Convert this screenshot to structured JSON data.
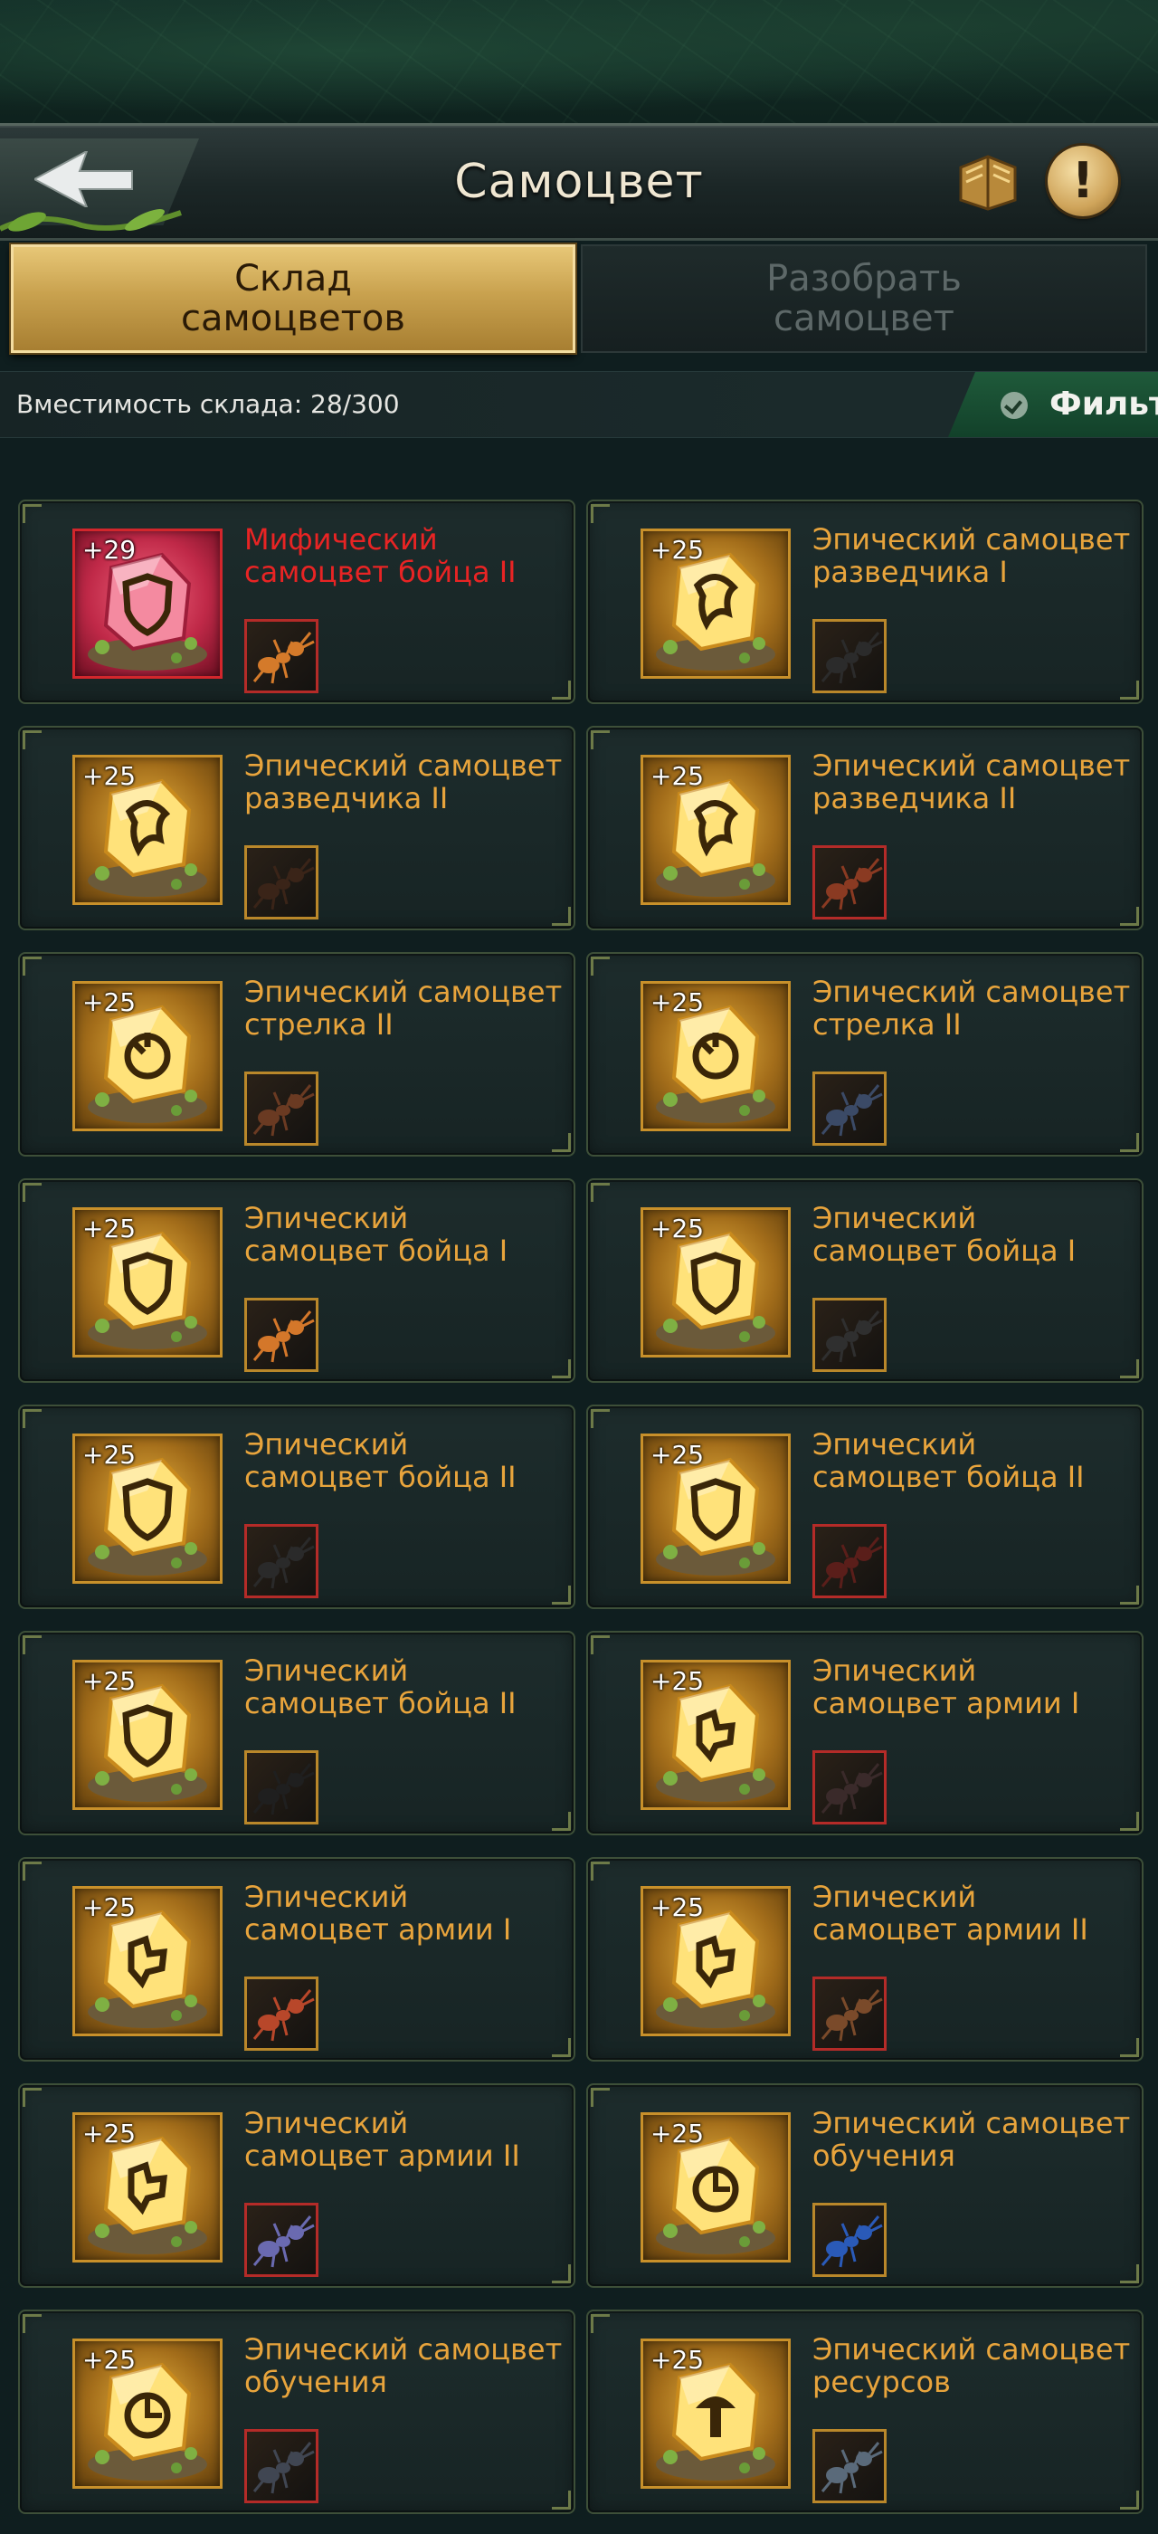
{
  "header": {
    "title": "Самоцвет",
    "back_icon": "back-arrow-icon",
    "book_icon": "book-icon",
    "info_icon": "info-icon",
    "info_glyph": "!"
  },
  "tabs": [
    {
      "label": "Склад\nсамоцветов",
      "active": true
    },
    {
      "label": "Разобрать\nсамоцвет",
      "active": false
    }
  ],
  "capacity": {
    "text": "Вместимость склада: 28/300"
  },
  "filter": {
    "label": "Фильт"
  },
  "colors": {
    "epic": "#e8a43c",
    "mythic": "#e82424",
    "tab_active": "#c9a24f",
    "filter_green": "#1f5a3a"
  },
  "gems": [
    {
      "level": "+29",
      "name": "Мифический\nсамоцвет бойца II",
      "rarity": "mythic",
      "slot": "red",
      "insect_color": "#d47a2a",
      "emblem": "shield"
    },
    {
      "level": "+25",
      "name": "Эпический самоцвет\nразведчика I",
      "rarity": "epic",
      "slot": "gold",
      "insect_color": "#2b2b2b",
      "emblem": "scout"
    },
    {
      "level": "+25",
      "name": "Эпический самоцвет\nразведчика II",
      "rarity": "epic",
      "slot": "gold",
      "insect_color": "#3a2418",
      "emblem": "scout"
    },
    {
      "level": "+25",
      "name": "Эпический самоцвет\nразведчика II",
      "rarity": "epic",
      "slot": "red",
      "insect_color": "#8a3a22",
      "emblem": "scout"
    },
    {
      "level": "+25",
      "name": "Эпический самоцвет\nстрелка II",
      "rarity": "epic",
      "slot": "gold",
      "insect_color": "#6a3a22",
      "emblem": "archer"
    },
    {
      "level": "+25",
      "name": "Эпический самоцвет\nстрелка II",
      "rarity": "epic",
      "slot": "gold",
      "insect_color": "#3b4a66",
      "emblem": "archer"
    },
    {
      "level": "+25",
      "name": "Эпический\nсамоцвет бойца I",
      "rarity": "epic",
      "slot": "gold",
      "insect_color": "#d4772a",
      "emblem": "shield"
    },
    {
      "level": "+25",
      "name": "Эпический\nсамоцвет бойца I",
      "rarity": "epic",
      "slot": "gold",
      "insect_color": "#2f2f2f",
      "emblem": "shield"
    },
    {
      "level": "+25",
      "name": "Эпический\nсамоцвет бойца II",
      "rarity": "epic",
      "slot": "red",
      "insect_color": "#2a2a2a",
      "emblem": "shield"
    },
    {
      "level": "+25",
      "name": "Эпический\nсамоцвет бойца II",
      "rarity": "epic",
      "slot": "red",
      "insect_color": "#5a1e1a",
      "emblem": "shield"
    },
    {
      "level": "+25",
      "name": "Эпический\nсамоцвет бойца II",
      "rarity": "epic",
      "slot": "gold",
      "insect_color": "#1f1f1f",
      "emblem": "shield"
    },
    {
      "level": "+25",
      "name": "Эпический\nсамоцвет армии I",
      "rarity": "epic",
      "slot": "red",
      "insect_color": "#3a2a2a",
      "emblem": "army"
    },
    {
      "level": "+25",
      "name": "Эпический\nсамоцвет армии I",
      "rarity": "epic",
      "slot": "gold",
      "insect_color": "#b8472a",
      "emblem": "army"
    },
    {
      "level": "+25",
      "name": "Эпический\nсамоцвет армии II",
      "rarity": "epic",
      "slot": "red",
      "insect_color": "#7a4a2a",
      "emblem": "army"
    },
    {
      "level": "+25",
      "name": "Эпический\nсамоцвет армии II",
      "rarity": "epic",
      "slot": "red",
      "insect_color": "#6a6ab0",
      "emblem": "army"
    },
    {
      "level": "+25",
      "name": "Эпический самоцвет\nобучения",
      "rarity": "epic",
      "slot": "gold",
      "insect_color": "#2a5ab8",
      "emblem": "training"
    },
    {
      "level": "+25",
      "name": "Эпический самоцвет\nобучения",
      "rarity": "epic",
      "slot": "red",
      "insect_color": "#404652",
      "emblem": "training"
    },
    {
      "level": "+25",
      "name": "Эпический самоцвет\nресурсов",
      "rarity": "epic",
      "slot": "gold",
      "insect_color": "#5a6a7a",
      "emblem": "resource"
    }
  ]
}
